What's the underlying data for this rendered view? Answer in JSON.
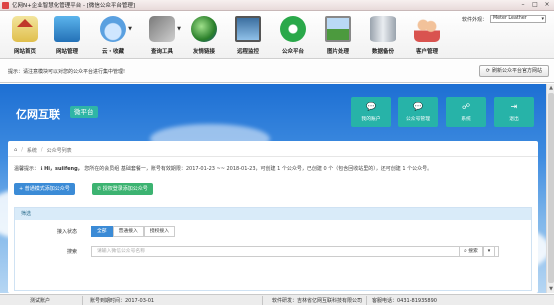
{
  "window": {
    "title": "亿网N+企业智慧化管理平台 - [微信公众平台管理]",
    "controls": [
      "–",
      "□",
      "×"
    ]
  },
  "toolbar": {
    "items": [
      {
        "label": "网站首页",
        "icon": "home-icon"
      },
      {
        "label": "网站管理",
        "icon": "network-icon"
      },
      {
        "label": "云・收藏",
        "icon": "cloud-icon"
      },
      {
        "label": "查询工具",
        "icon": "tools-icon"
      },
      {
        "label": "友情链接",
        "icon": "globe-icon"
      },
      {
        "label": "远程监控",
        "icon": "monitor-icon"
      },
      {
        "label": "公众平台",
        "icon": "wechat-icon"
      },
      {
        "label": "图片处理",
        "icon": "image-icon"
      },
      {
        "label": "数据备份",
        "icon": "database-icon"
      },
      {
        "label": "客户管理",
        "icon": "users-icon"
      }
    ],
    "skin_label": "软件外观：",
    "skin_value": "Meter Leather"
  },
  "notice": {
    "text": "提示：请注意模块可以对您的公众平台进行集中管理!",
    "refresh_button": "刷新公众平台官方网站"
  },
  "site": {
    "brand": "亿网互联",
    "brand_tag": "微平台",
    "nav": [
      {
        "label": "我的账户",
        "icon": "chat-icon"
      },
      {
        "label": "公众号管理",
        "icon": "chat-icon"
      },
      {
        "label": "系统",
        "icon": "sitemap-icon"
      },
      {
        "label": "退出",
        "icon": "logout-icon"
      }
    ],
    "breadcrumb": [
      "系统",
      "公众号列表"
    ],
    "tip_prefix": "温馨提示：",
    "tip_user": "Hi，suiifeng，",
    "tip_text": "您所在的会员组 基础套餐一，账号有效期限：2017-01-23 ~~ 2018-01-23，可创建 1 个公众号，已创建 0 个（包含回收站里的），还可创建 1 个公众号。",
    "btn_add_normal": "普通模式添加公众号",
    "btn_add_auth": "授权登录添加公众号",
    "filter_header": "筛选",
    "access_label": "接入状态",
    "access_options": [
      "全部",
      "普通接入",
      "授权接入"
    ],
    "search_label": "搜索",
    "search_placeholder": "请输入微信公众号名称",
    "search_button": "搜索"
  },
  "status": {
    "user": "测试账户",
    "expire": "账号到期时间：2017-03-01",
    "support": "软件研发：吉林省亿网互联科技有限公司",
    "phone": "客服电话：0431-81935890"
  }
}
